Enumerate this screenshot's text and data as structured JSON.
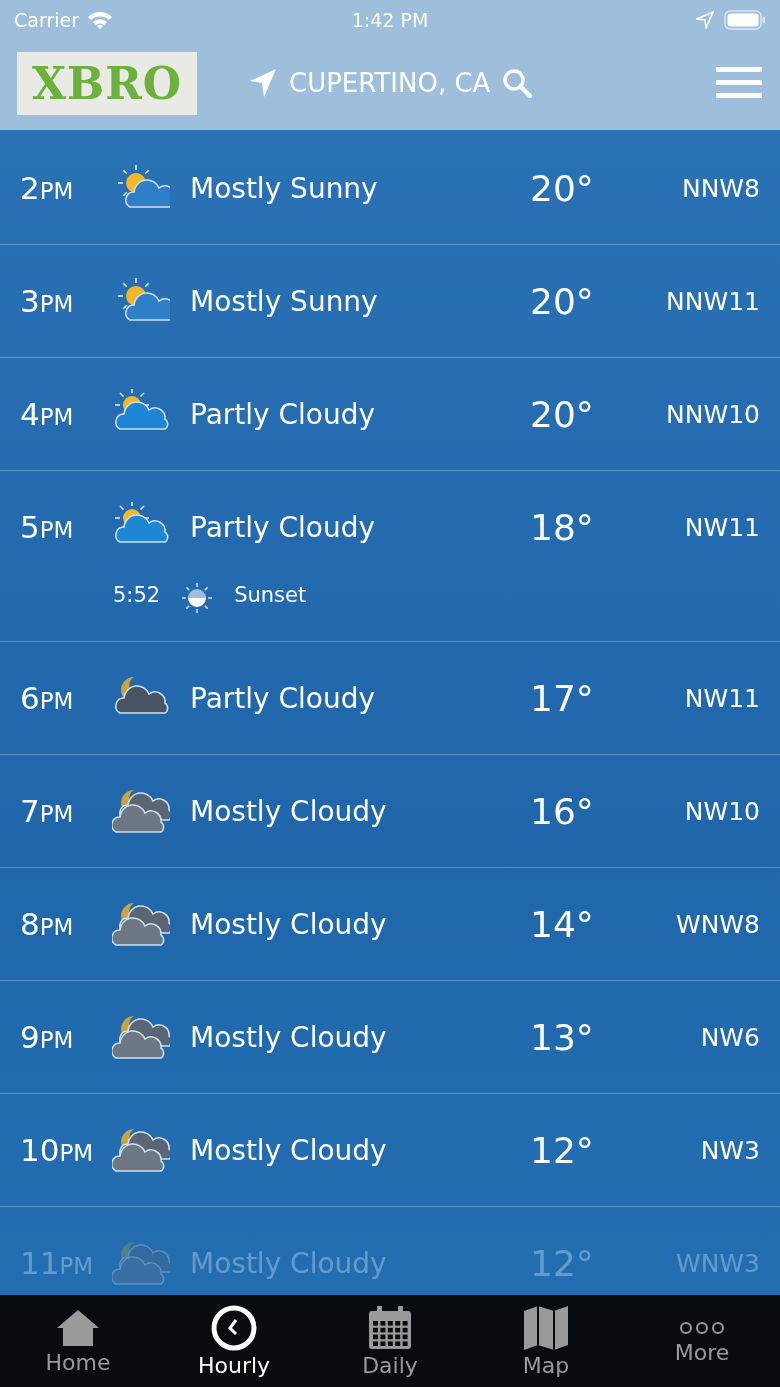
{
  "status_bar": {
    "carrier": "Carrier",
    "time": "1:42 PM"
  },
  "header": {
    "logo": "XBRO",
    "location": "CUPERTINO, CA"
  },
  "hours": [
    {
      "hour": "2",
      "period": "PM",
      "kind": "mostly-sunny",
      "condition": "Mostly Sunny",
      "temp": "20°",
      "wind": "NNW8",
      "faded": false
    },
    {
      "hour": "3",
      "period": "PM",
      "kind": "mostly-sunny",
      "condition": "Mostly Sunny",
      "temp": "20°",
      "wind": "NNW11",
      "faded": false
    },
    {
      "hour": "4",
      "period": "PM",
      "kind": "partly-day",
      "condition": "Partly Cloudy",
      "temp": "20°",
      "wind": "NNW10",
      "faded": false
    },
    {
      "hour": "5",
      "period": "PM",
      "kind": "partly-day",
      "condition": "Partly Cloudy",
      "temp": "18°",
      "wind": "NW11",
      "faded": false,
      "event": {
        "time": "5:52",
        "label": "Sunset"
      }
    },
    {
      "hour": "6",
      "period": "PM",
      "kind": "partly-night",
      "condition": "Partly Cloudy",
      "temp": "17°",
      "wind": "NW11",
      "faded": false
    },
    {
      "hour": "7",
      "period": "PM",
      "kind": "cloudy-night",
      "condition": "Mostly Cloudy",
      "temp": "16°",
      "wind": "NW10",
      "faded": false
    },
    {
      "hour": "8",
      "period": "PM",
      "kind": "cloudy-night",
      "condition": "Mostly Cloudy",
      "temp": "14°",
      "wind": "WNW8",
      "faded": false
    },
    {
      "hour": "9",
      "period": "PM",
      "kind": "cloudy-night",
      "condition": "Mostly Cloudy",
      "temp": "13°",
      "wind": "NW6",
      "faded": false
    },
    {
      "hour": "10",
      "period": "PM",
      "kind": "cloudy-night",
      "condition": "Mostly Cloudy",
      "temp": "12°",
      "wind": "NW3",
      "faded": false
    },
    {
      "hour": "11",
      "period": "PM",
      "kind": "cloudy-night",
      "condition": "Mostly Cloudy",
      "temp": "12°",
      "wind": "WNW3",
      "faded": true
    }
  ],
  "tabs": [
    {
      "label": "Home",
      "selected": false
    },
    {
      "label": "Hourly",
      "selected": true
    },
    {
      "label": "Daily",
      "selected": false
    },
    {
      "label": "Map",
      "selected": false
    },
    {
      "label": "More",
      "selected": false
    }
  ]
}
